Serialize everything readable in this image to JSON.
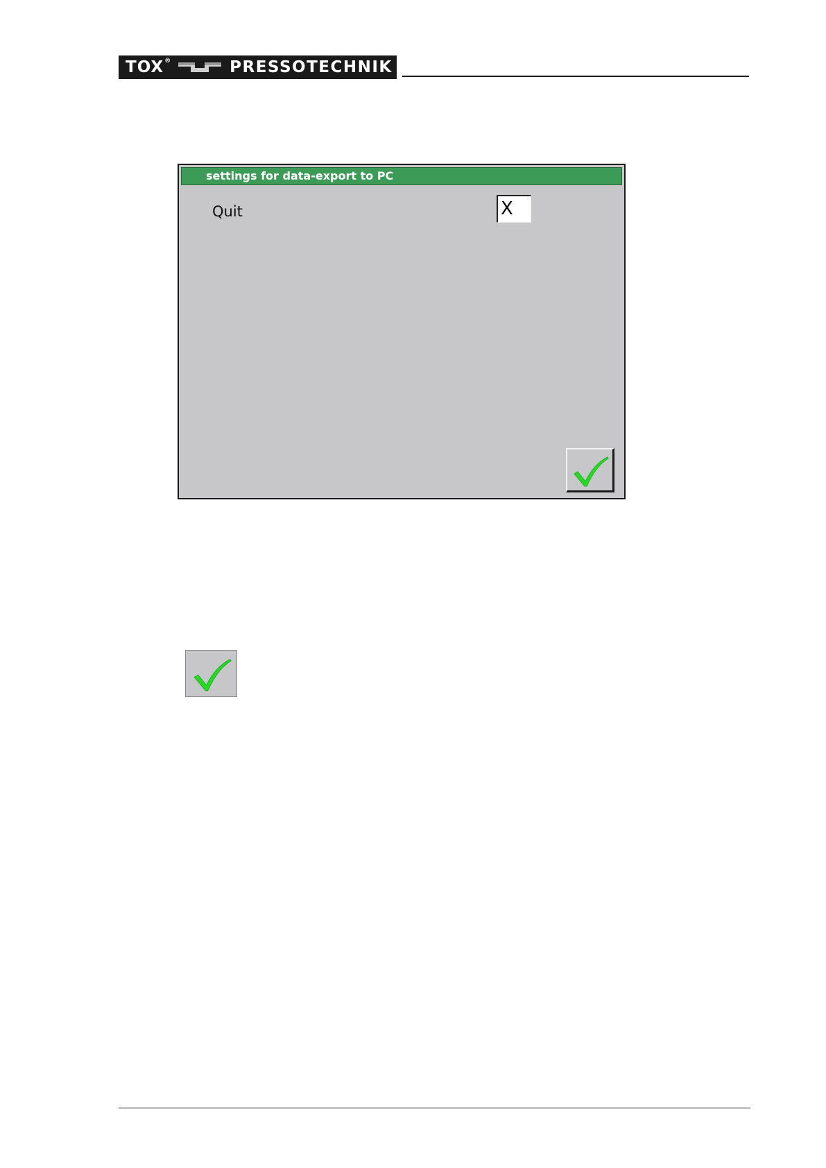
{
  "header": {
    "logo": {
      "brand": "TOX",
      "registered": "®",
      "company": "PRESSOTECHNIK",
      "background_color": "#1a1a1a",
      "text_color": "#ffffff"
    }
  },
  "dialog": {
    "title": "settings for data-export to PC",
    "title_bar_color": "#3d9b58",
    "background_color": "#c7c6c8",
    "fields": [
      {
        "label": "Quit",
        "value": "X"
      }
    ],
    "confirm_button": {
      "icon": "checkmark-icon",
      "icon_color": "#22dd22"
    }
  },
  "illustration": {
    "icon": "checkmark-icon",
    "icon_color": "#22dd22"
  }
}
